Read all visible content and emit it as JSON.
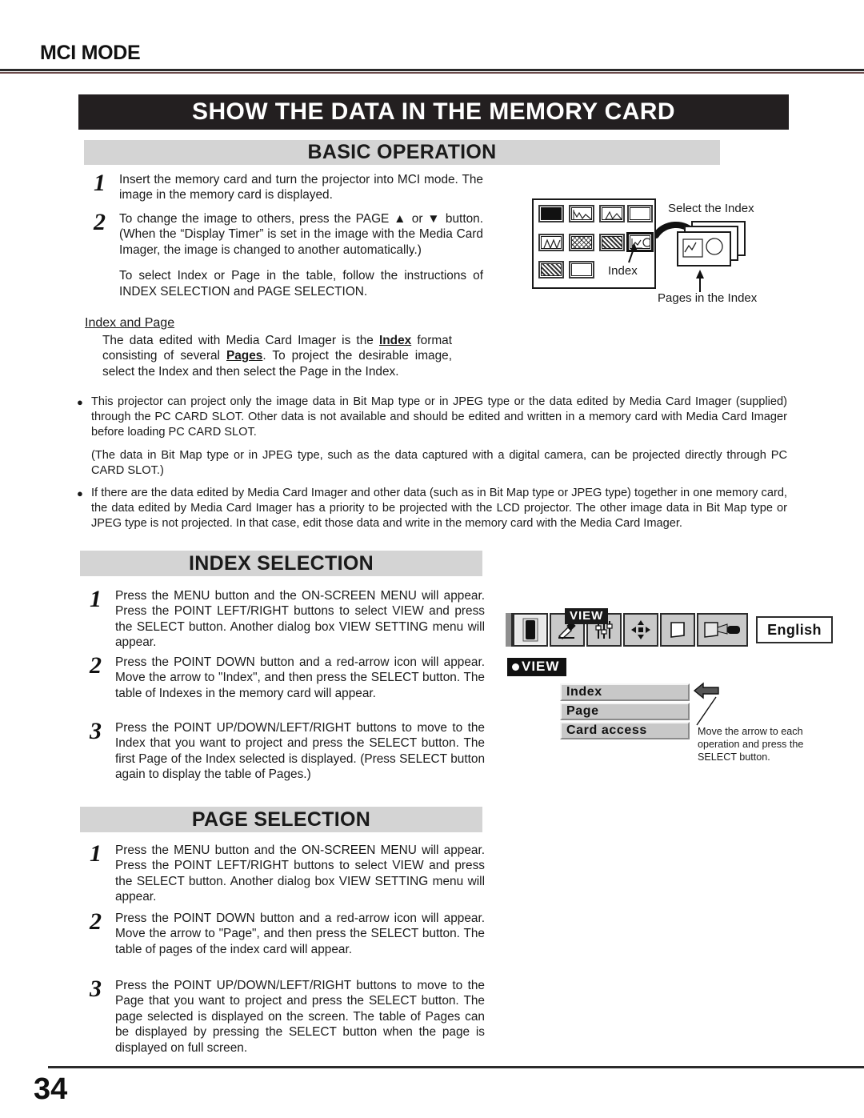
{
  "header": {
    "mode_label": "MCI MODE"
  },
  "title": "SHOW THE DATA IN THE MEMORY CARD",
  "sections": {
    "basic": {
      "heading": "BASIC OPERATION",
      "steps": [
        {
          "number": "1",
          "paragraphs": [
            "Insert the memory card and turn the projector into MCI mode. The image in the memory card is displayed."
          ]
        },
        {
          "number": "2",
          "paragraphs": [
            "To change the image to others, press the PAGE ▲ or ▼ button.   (When the “Display Timer” is set in the image with the Media Card Imager, the image is changed to another automatically.)",
            "To select Index or Page in the table, follow the instructions of INDEX SELECTION and PAGE SELECTION."
          ]
        }
      ],
      "subhead": "Index and Page",
      "subhead_body_1": "The data edited with Media Card Imager is the ",
      "subhead_body_bold_1": "Index",
      "subhead_body_2": " format consisting of several ",
      "subhead_body_bold_2": "Pages",
      "subhead_body_3": ". To project the desirable image, select the Index and then select the Page in the Index.",
      "bullets": [
        "This projector can project only the image data in Bit Map type or in JPEG type or the data edited by Media Card Imager (supplied) through the PC CARD SLOT.  Other data is not available and should be edited and written in a memory card with Media Card Imager before loading PC CARD SLOT.",
        "If there are the data edited by Media Card Imager and other data (such as in Bit Map type or JPEG type) together in one memory card, the data edited by Media Card Imager has a priority to be projected with the LCD projector. The other image data in Bit Map type or JPEG type is not projected.  In that case, edit those data and write in the memory card with the Media Card Imager."
      ],
      "bullet_note": "(The data in Bit Map type or in JPEG type, such as the data captured with a digital camera, can be projected directly through PC CARD SLOT.)",
      "diagram": {
        "label_select_index": "Select the Index",
        "label_index": "Index",
        "label_pages": "Pages in the Index"
      }
    },
    "index_selection": {
      "heading": "INDEX SELECTION",
      "steps": [
        {
          "number": "1",
          "paragraphs": [
            "Press the MENU button and the ON-SCREEN MENU will appear.  Press the POINT LEFT/RIGHT buttons to select VIEW and press the SELECT button.  Another dialog box VIEW SETTING menu will appear."
          ]
        },
        {
          "number": "2",
          "paragraphs": [
            "Press the POINT DOWN button and a red-arrow icon will appear.  Move the arrow to \"Index\", and then press the SELECT button.  The table of Indexes in the memory card will appear."
          ]
        },
        {
          "number": "3",
          "paragraphs": [
            "Press the POINT UP/DOWN/LEFT/RIGHT buttons to move to the Index that you want to project and press the SELECT button.  The first Page of the Index selected is displayed. (Press SELECT button again to display the table of Pages.)"
          ]
        }
      ],
      "osd": {
        "menu_tag": "VIEW",
        "language_value": "English",
        "icons": [
          "memory-card-icon",
          "image-adjust-icon",
          "sliders-icon",
          "four-way-arrows-icon",
          "screen-icon",
          "projector-screen-icon"
        ]
      },
      "dialog": {
        "badge": "VIEW",
        "items": [
          "Index",
          "Page",
          "Card access"
        ]
      },
      "annotation": "Move the arrow to each operation and press the SELECT button."
    },
    "page_selection": {
      "heading": "PAGE SELECTION",
      "steps": [
        {
          "number": "1",
          "paragraphs": [
            "Press the MENU button and the ON-SCREEN MENU will appear.  Press the POINT LEFT/RIGHT buttons to select VIEW and press the SELECT button.  Another dialog box VIEW SETTING menu will appear."
          ]
        },
        {
          "number": "2",
          "paragraphs": [
            "Press the POINT DOWN button and a red-arrow icon will appear.  Move the arrow to \"Page\", and then press the SELECT button.  The table of pages of the index card will appear."
          ]
        },
        {
          "number": "3",
          "paragraphs": [
            "Press the POINT UP/DOWN/LEFT/RIGHT buttons to move to the Page that you want to project and press the SELECT button.  The page selected is displayed on the screen. The table of Pages can be displayed by pressing the SELECT button when the page is displayed on full screen."
          ]
        }
      ]
    }
  },
  "footer": {
    "page_number": "34"
  },
  "colors": {
    "title_bar": "#231f20",
    "section_bar": "#d4d4d4",
    "accent_rule": "#6b4a4a"
  }
}
